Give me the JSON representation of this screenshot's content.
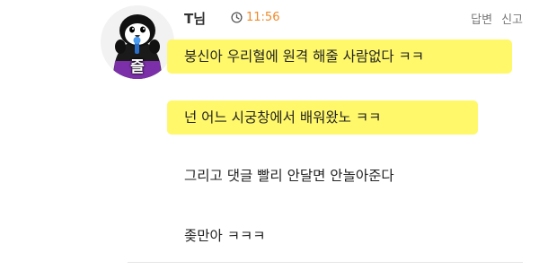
{
  "comment": {
    "author": "T님",
    "time": "11:56",
    "avatar": {
      "caption": "즐",
      "icon": "cartoon-penguin-avatar"
    },
    "actions": {
      "reply_label": "답변",
      "report_label": "신고"
    },
    "lines": [
      "붕신아 우리혈에 원격 해줄 사람없다 ㅋㅋ",
      "넌 어느 시궁창에서 배워왔노 ㅋㅋ",
      "그리고 댓글 빨리 안달면 안놀아준다",
      "좆만아 ㅋㅋㅋ"
    ],
    "highlighted_lines": [
      0,
      1
    ],
    "colors": {
      "highlight": "#fff86a",
      "time": "#f08a2a",
      "action": "#777777"
    }
  }
}
